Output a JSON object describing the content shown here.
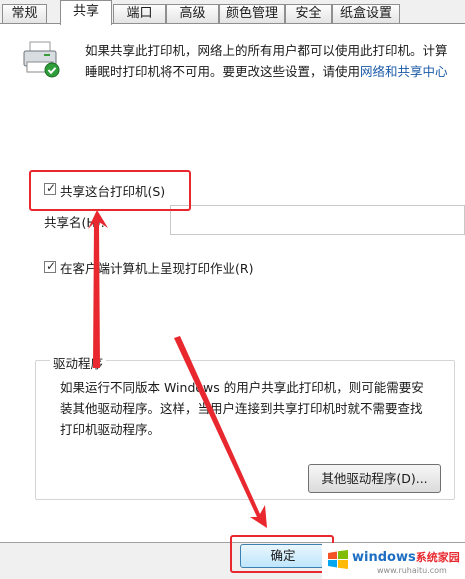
{
  "tabs": [
    {
      "label": "常规",
      "active": false
    },
    {
      "label": "共享",
      "active": true
    },
    {
      "label": "端口",
      "active": false
    },
    {
      "label": "高级",
      "active": false
    },
    {
      "label": "颜色管理",
      "active": false
    },
    {
      "label": "安全",
      "active": false
    },
    {
      "label": "纸盒设置",
      "active": false
    }
  ],
  "sharing": {
    "intro_line1": "如果共享此打印机，网络上的所有用户都可以使用此打印机。计算",
    "intro_line2_prefix": "睡眠时打印机将不可用。要更改这些设置，请使用",
    "intro_link": "网络和共享中心",
    "share_checkbox_label": "共享这台打印机(S)",
    "share_checked": true,
    "share_name_label": "共享名(H):",
    "share_name_value": "",
    "render_jobs_label": "在客户端计算机上呈现打印作业(R)",
    "render_jobs_checked": true
  },
  "drivers": {
    "group_title": "驱动程序",
    "line1": "如果运行不同版本 Windows 的用户共享此打印机，则可能需要安",
    "line2": "装其他驱动程序。这样，当用户连接到共享打印机时就不需要查找",
    "line3": "打印机驱动程序。",
    "button_label": "其他驱动程序(D)..."
  },
  "footer": {
    "ok_label": "确定"
  },
  "watermark": {
    "brand": "windows",
    "brand_cn": "系统家园",
    "url": "www.ruhaitu.com"
  },
  "colors": {
    "annotation_red": "#e8282e",
    "link_blue": "#1a5aa8"
  }
}
